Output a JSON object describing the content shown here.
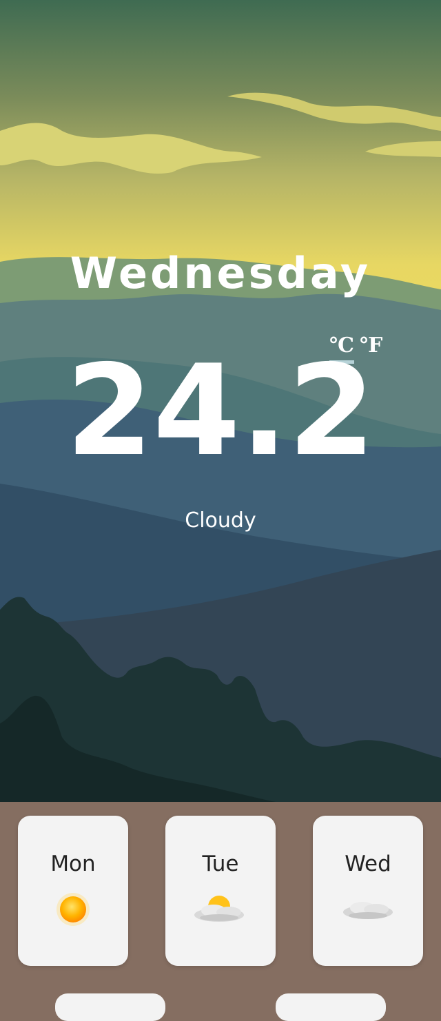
{
  "current": {
    "day": "Wednesday",
    "temperature": "24.2",
    "condition": "Cloudy",
    "units": {
      "celsius": "℃",
      "fahrenheit": "℉",
      "selected": "celsius"
    }
  },
  "forecast": [
    {
      "day": "Mon",
      "icon": "sun-icon"
    },
    {
      "day": "Tue",
      "icon": "partly-cloudy-icon"
    },
    {
      "day": "Wed",
      "icon": "cloud-icon"
    }
  ],
  "colors": {
    "sky_top": "#3f6b52",
    "sky_mid": "#e7d763",
    "forecast_panel": "#856e61",
    "card": "#f3f3f3"
  }
}
